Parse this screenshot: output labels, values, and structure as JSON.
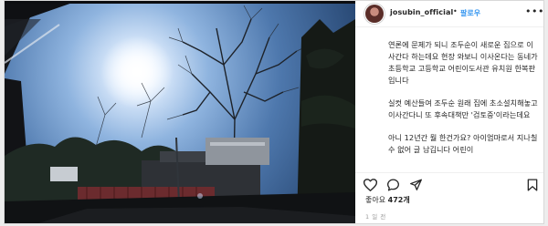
{
  "post": {
    "username": "josubin_official",
    "separator": "•",
    "follow_label": "팔로우",
    "more_label": "•••",
    "caption": [
      "연론에 문제가 되니 조두순이 새로운 집으로 이사간다 하는데요 현장 와보니 이사온다는 동네가 초등학교 고등학교 어린이도서관 유치원 한복판입니다",
      "실컷 예산들여 조두순 원래 집에 초소설치해놓고 이사간다니 또 후속대책만 '검토중'이라는데요",
      "아니 12년간 뭘 한건가요? 아이엄마로서 지나칠 수 없어 글 남깁니다 어린이"
    ],
    "likes_prefix": "좋아요",
    "likes_count": "472개",
    "timestamp": "1 일 전"
  },
  "icons": {
    "like": "heart-icon",
    "comment": "comment-icon",
    "share": "paper-plane-icon",
    "save": "bookmark-icon"
  }
}
